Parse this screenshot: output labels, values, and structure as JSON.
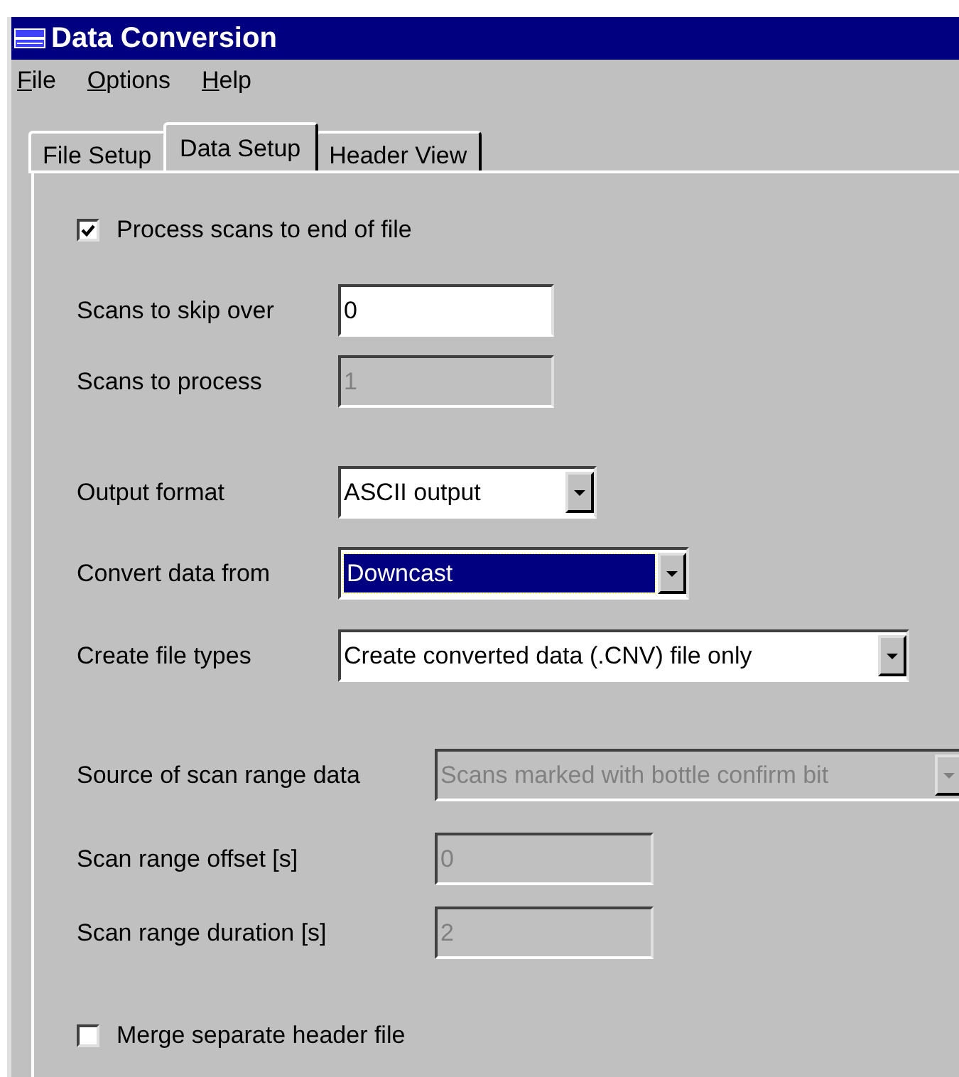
{
  "window": {
    "title": "Data Conversion"
  },
  "menu": [
    {
      "label": "File"
    },
    {
      "label": "Options"
    },
    {
      "label": "Help"
    }
  ],
  "tabs": [
    {
      "label": "File Setup",
      "selected": false
    },
    {
      "label": "Data Setup",
      "selected": true
    },
    {
      "label": "Header View",
      "selected": false
    }
  ],
  "form": [
    {
      "kind": "checkbox",
      "label": "Process scans to end of file",
      "checked": true
    },
    {
      "kind": "text",
      "label": "Scans to skip over",
      "value": "0",
      "disabled": false
    },
    {
      "kind": "text",
      "label": "Scans to process",
      "value": "1",
      "disabled": true
    },
    {
      "kind": "combo",
      "label": "Output format",
      "value": "ASCII output",
      "disabled": false,
      "focused": false
    },
    {
      "kind": "combo",
      "label": "Convert data from",
      "value": "Downcast",
      "disabled": false,
      "focused": true
    },
    {
      "kind": "combo",
      "label": "Create file types",
      "value": "Create converted data (.CNV) file only",
      "disabled": false,
      "focused": false
    },
    {
      "kind": "combo",
      "label": "Source of scan range data",
      "value": "Scans marked with bottle confirm bit",
      "disabled": true,
      "focused": false
    },
    {
      "kind": "text",
      "label": "Scan range offset [s]",
      "value": "0",
      "disabled": true
    },
    {
      "kind": "text",
      "label": "Scan range duration [s]",
      "value": "2",
      "disabled": true
    },
    {
      "kind": "checkbox",
      "label": "Merge separate header file",
      "checked": false
    }
  ]
}
